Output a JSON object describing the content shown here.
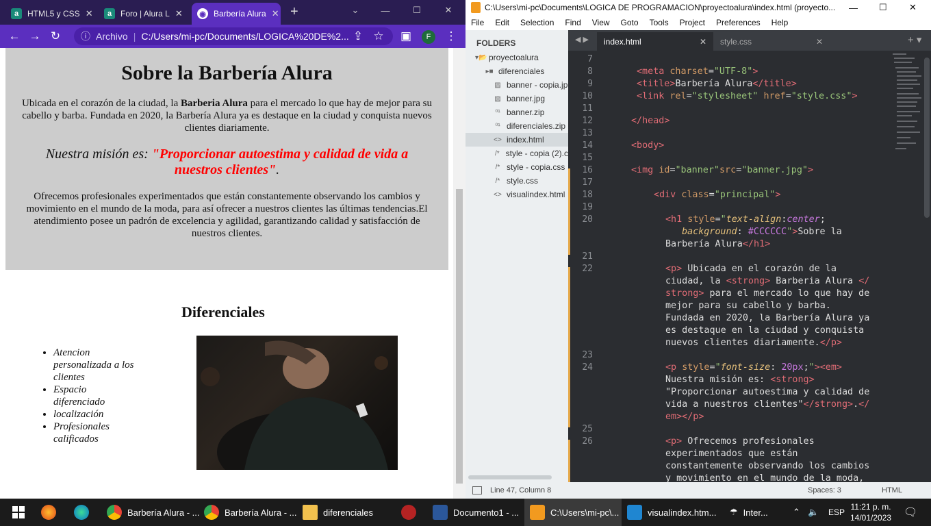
{
  "browser": {
    "tabs": [
      {
        "label": "HTML5 y CSS",
        "favicon": "a"
      },
      {
        "label": "Foro | Alura L",
        "favicon": "a"
      },
      {
        "label": "Barbería Alura",
        "favicon": "globe"
      }
    ],
    "address_prefix": "Archivo",
    "address_url": "C:/Users/mi-pc/Documents/LOGICA%20DE%2...",
    "profile_initial": "F"
  },
  "page": {
    "title": "Sobre la Barbería Alura",
    "p1_before": "Ubicada en el corazón de la ciudad, la ",
    "p1_strong": "Barberia Alura",
    "p1_after": " para el mercado lo que hay de mejor para su cabello y barba. Fundada en 2020, la Barbería Alura ya es destaque en la ciudad y conquista nuevos clientes diariamente.",
    "mission_prefix": "Nuestra misión es: ",
    "mission_strong": "\"Proporcionar autoestima y calidad de vida a nuestros clientes\"",
    "mission_suffix": ".",
    "p3": "Ofrecemos profesionales experimentados que están constantemente observando los cambios y movimiento en el mundo de la moda, para así ofrecer a nuestros clientes las últimas tendencias.El atendimiento posee un padrón de excelencia y agilidad, garantizando calidad y satisfacción de nuestros clientes.",
    "diferenciales_title": "Diferenciales",
    "diferenciales_items": [
      "Atencion personalizada a los clientes",
      "Espacio diferenciado",
      "localización",
      "Profesionales calificados"
    ]
  },
  "sublime": {
    "window_title": "C:\\Users\\mi-pc\\Documents\\LOGICA DE PROGRAMACION\\proyectoalura\\index.html (proyecto...",
    "menu": [
      "File",
      "Edit",
      "Selection",
      "Find",
      "View",
      "Goto",
      "Tools",
      "Project",
      "Preferences",
      "Help"
    ],
    "folders_header": "FOLDERS",
    "files": [
      {
        "name": "proyectoalura",
        "icon": "folder-open-icon"
      },
      {
        "name": "diferenciales",
        "icon": "folder-icon"
      },
      {
        "name": "banner - copia.jp",
        "icon": "image-icon"
      },
      {
        "name": "banner.jpg",
        "icon": "image-icon"
      },
      {
        "name": "banner.zip",
        "icon": "binary-icon"
      },
      {
        "name": "diferenciales.zip",
        "icon": "binary-icon"
      },
      {
        "name": "index.html",
        "icon": "code-icon"
      },
      {
        "name": "style - copia (2).c",
        "icon": "comment-icon"
      },
      {
        "name": "style - copia.css",
        "icon": "comment-icon"
      },
      {
        "name": "style.css",
        "icon": "comment-icon"
      },
      {
        "name": "visualindex.html",
        "icon": "code-icon"
      }
    ],
    "tabs": [
      "index.html",
      "style.css"
    ],
    "line_numbers": [
      "7",
      "8",
      "9",
      "10",
      "11",
      "12",
      "13",
      "14",
      "15",
      "16",
      "17",
      "18",
      "19",
      "20",
      "21",
      "22",
      "23",
      "24",
      "25",
      "26"
    ],
    "status_left": "Line 47, Column 8",
    "status_spaces": "Spaces: 3",
    "status_syntax": "HTML"
  },
  "taskbar": {
    "items": [
      "Barbería Alura - ...",
      "Barbería Alura - ...",
      "diferenciales",
      "Documento1 - ...",
      "C:\\Users\\mi-pc\\...",
      "visualindex.htm...",
      "Inter..."
    ],
    "lang": "ESP",
    "time": "11:21 p. m.",
    "date": "14/01/2023"
  },
  "colors": {
    "browser_accent": "#5b2fbf",
    "mission_red": "#ff0000",
    "principal_bg": "#cccccc"
  }
}
